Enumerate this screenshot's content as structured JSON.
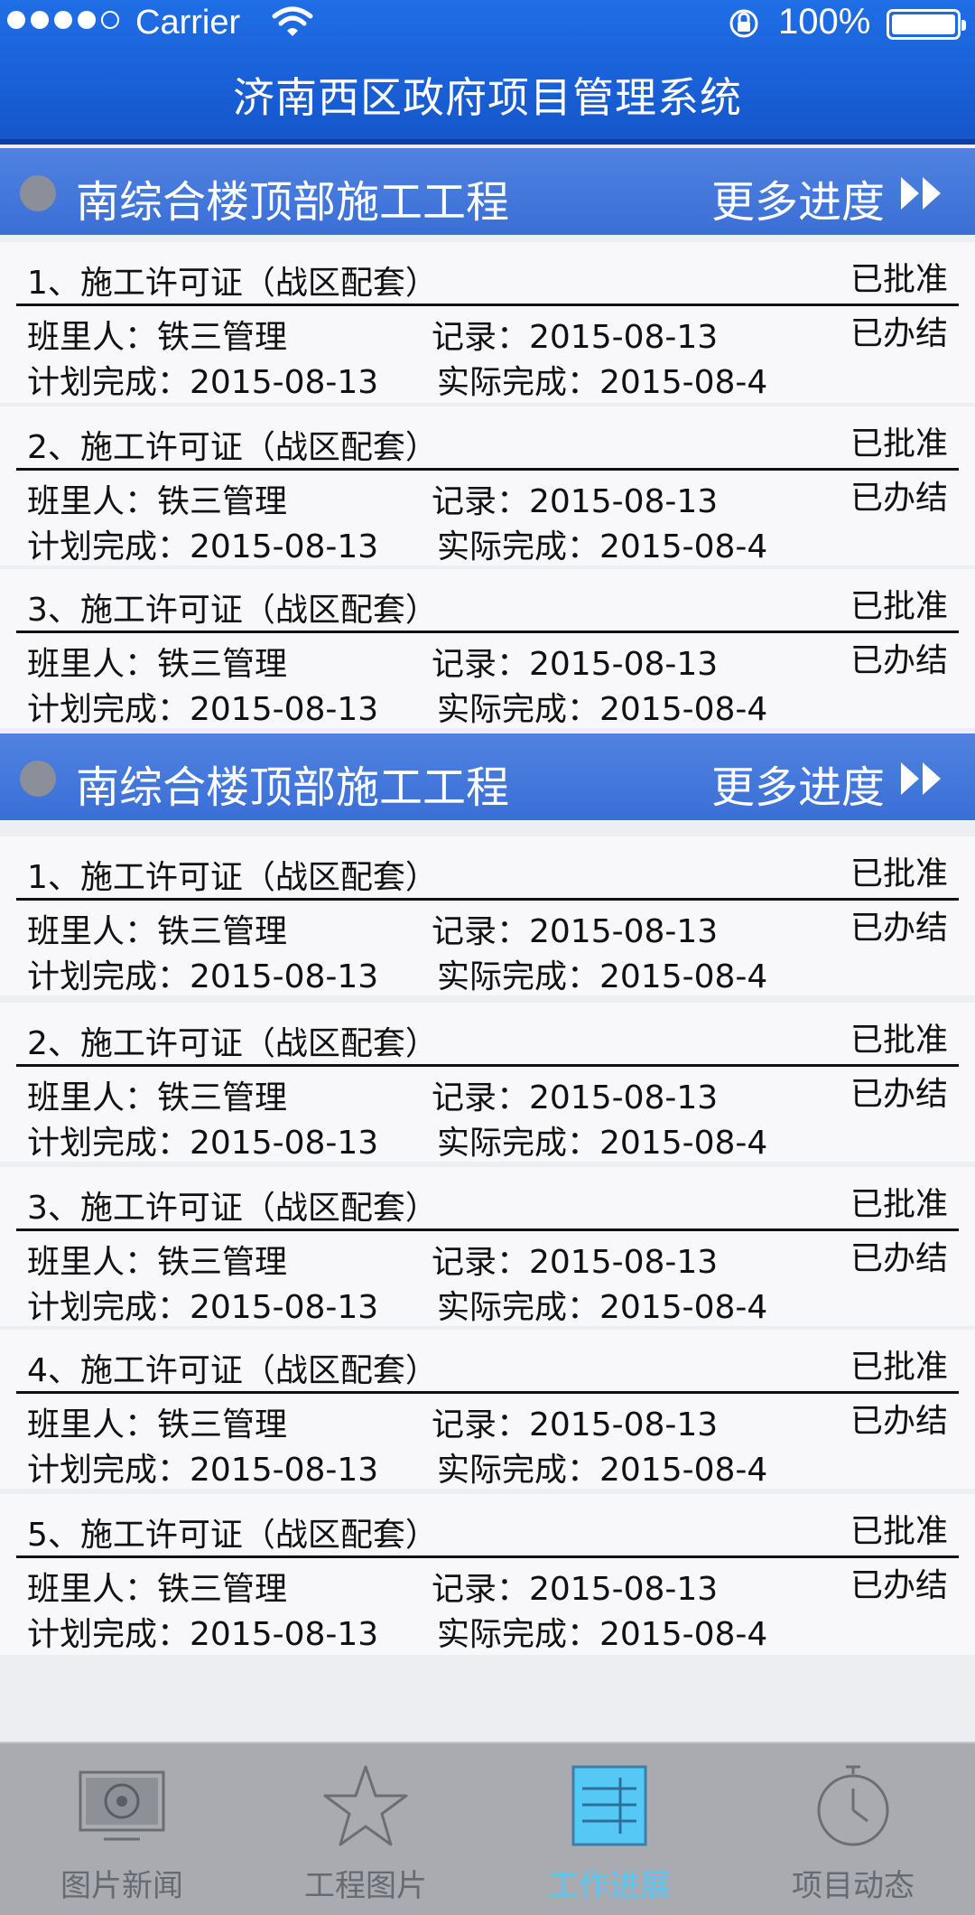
{
  "status_bar": {
    "carrier": "Carrier",
    "battery": "100%"
  },
  "header": {
    "title": "济南西区政府项目管理系统"
  },
  "sections": [
    {
      "title": "南综合楼顶部施工工程",
      "more_label": "更多进度",
      "items": [
        {
          "name": "1、施工许可证（战区配套）",
          "approval": "已批准",
          "handler": "班里人：铁三管理",
          "record": "记录：2015-08-13",
          "status": "已办结",
          "planned": "计划完成：2015-08-13",
          "actual": "实际完成：2015-08-4"
        },
        {
          "name": "2、施工许可证（战区配套）",
          "approval": "已批准",
          "handler": "班里人：铁三管理",
          "record": "记录：2015-08-13",
          "status": "已办结",
          "planned": "计划完成：2015-08-13",
          "actual": "实际完成：2015-08-4"
        },
        {
          "name": "3、施工许可证（战区配套）",
          "approval": "已批准",
          "handler": "班里人：铁三管理",
          "record": "记录：2015-08-13",
          "status": "已办结",
          "planned": "计划完成：2015-08-13",
          "actual": "实际完成：2015-08-4"
        }
      ]
    },
    {
      "title": "南综合楼顶部施工工程",
      "more_label": "更多进度",
      "items": [
        {
          "name": "1、施工许可证（战区配套）",
          "approval": "已批准",
          "handler": "班里人：铁三管理",
          "record": "记录：2015-08-13",
          "status": "已办结",
          "planned": "计划完成：2015-08-13",
          "actual": "实际完成：2015-08-4"
        },
        {
          "name": "2、施工许可证（战区配套）",
          "approval": "已批准",
          "handler": "班里人：铁三管理",
          "record": "记录：2015-08-13",
          "status": "已办结",
          "planned": "计划完成：2015-08-13",
          "actual": "实际完成：2015-08-4"
        },
        {
          "name": "3、施工许可证（战区配套）",
          "approval": "已批准",
          "handler": "班里人：铁三管理",
          "record": "记录：2015-08-13",
          "status": "已办结",
          "planned": "计划完成：2015-08-13",
          "actual": "实际完成：2015-08-4"
        },
        {
          "name": "4、施工许可证（战区配套）",
          "approval": "已批准",
          "handler": "班里人：铁三管理",
          "record": "记录：2015-08-13",
          "status": "已办结",
          "planned": "计划完成：2015-08-13",
          "actual": "实际完成：2015-08-4"
        },
        {
          "name": "5、施工许可证（战区配套）",
          "approval": "已批准",
          "handler": "班里人：铁三管理",
          "record": "记录：2015-08-13",
          "status": "已办结",
          "planned": "计划完成：2015-08-13",
          "actual": "实际完成：2015-08-4"
        }
      ]
    }
  ],
  "tabbar": {
    "tabs": [
      {
        "label": "图片新闻",
        "icon": "monitor-icon"
      },
      {
        "label": "工程图片",
        "icon": "star-icon"
      },
      {
        "label": "工作进展",
        "icon": "progress-grid-icon"
      },
      {
        "label": "项目动态",
        "icon": "clock-icon"
      }
    ],
    "active_index": 2,
    "active_color": "#56c8f5",
    "inactive_color": "#666a72"
  },
  "colors": {
    "header_blue": "#1a5fd6",
    "section_blue": "#3b6fd6"
  }
}
